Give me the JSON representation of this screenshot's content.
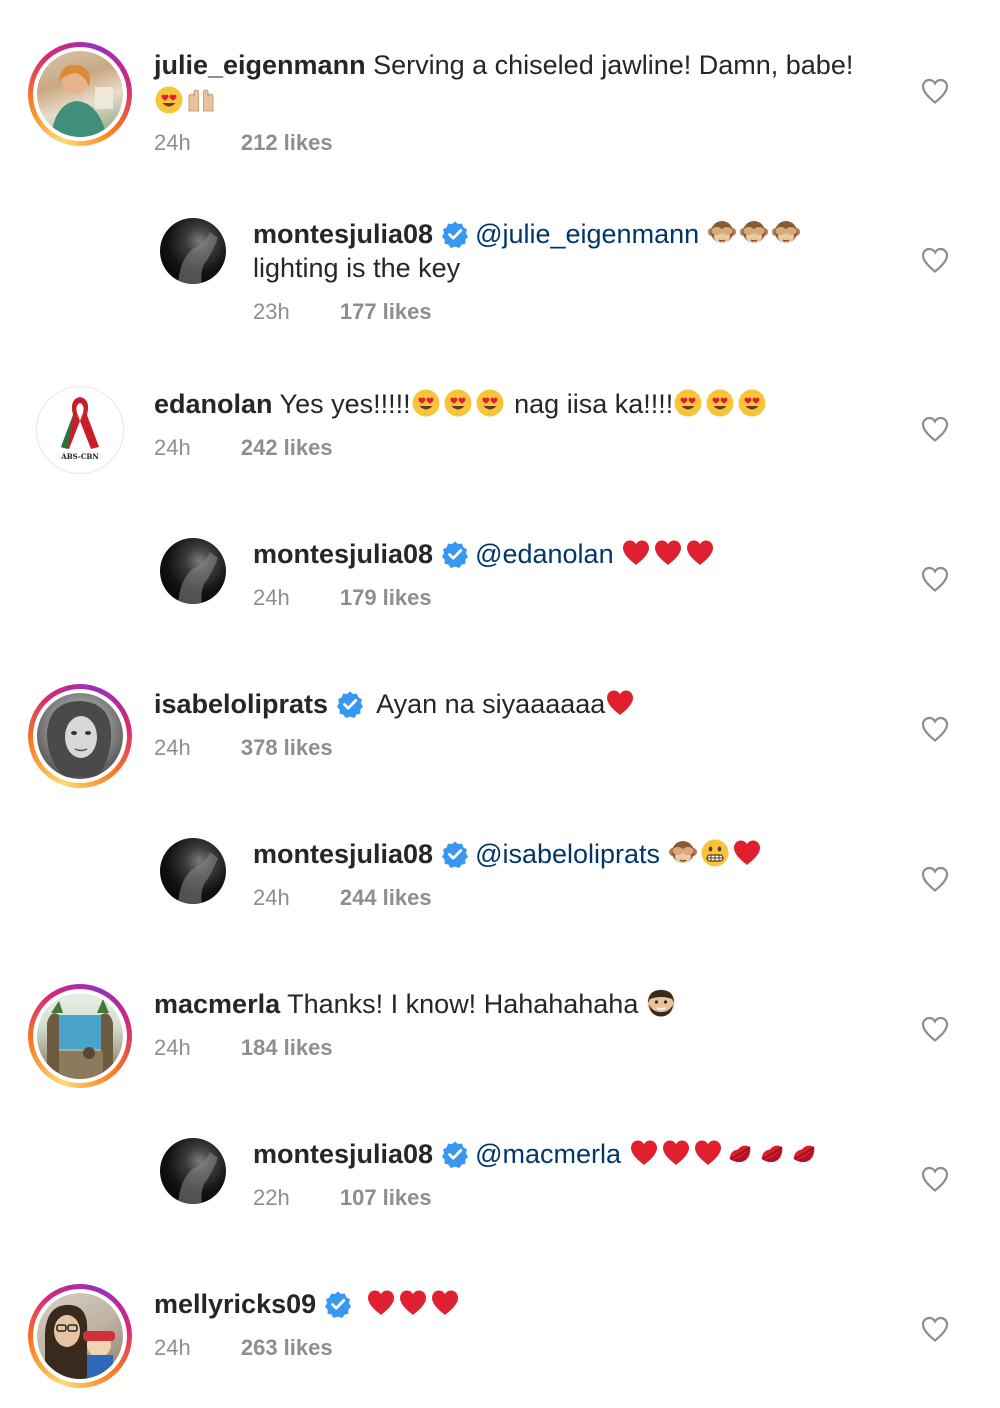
{
  "comments": [
    {
      "username": "julie_eigenmann",
      "text": "Serving a chiseled jawline! Damn, babe!",
      "time": "24h",
      "likes": "212 likes",
      "emojis": [
        "heart-eyes-emoji",
        "raised-hands-emoji"
      ]
    },
    {
      "username": "montesjulia08",
      "mention": "@julie_eigenmann",
      "text": "lighting is the key",
      "time": "23h",
      "likes": "177 likes",
      "emojis": [
        "see-no-evil-monkey-emoji",
        "see-no-evil-monkey-emoji",
        "see-no-evil-monkey-emoji"
      ]
    },
    {
      "username": "edanolan",
      "text": "Yes yes!!!!!",
      "text2": "nag iisa ka!!!!",
      "time": "24h",
      "likes": "242 likes",
      "logo_text": "ABS-CBN",
      "emojis": [
        "heart-eyes-emoji",
        "heart-eyes-emoji",
        "heart-eyes-emoji"
      ]
    },
    {
      "username": "montesjulia08",
      "mention": "@edanolan",
      "time": "24h",
      "likes": "179 likes",
      "emojis": [
        "red-heart-emoji",
        "red-heart-emoji",
        "red-heart-emoji"
      ]
    },
    {
      "username": "isabeloliprats",
      "text": "Ayan na siyaaaaaa",
      "time": "24h",
      "likes": "378 likes",
      "emojis": [
        "red-heart-emoji"
      ]
    },
    {
      "username": "montesjulia08",
      "mention": "@isabeloliprats",
      "time": "24h",
      "likes": "244 likes",
      "emojis": [
        "see-no-evil-monkey-emoji",
        "grimacing-face-emoji",
        "red-heart-emoji"
      ]
    },
    {
      "username": "macmerla",
      "text": "Thanks! I know! Hahahahaha",
      "time": "24h",
      "likes": "184 likes",
      "emojis": [
        "bearded-man-emoji"
      ]
    },
    {
      "username": "montesjulia08",
      "mention": "@macmerla",
      "time": "22h",
      "likes": "107 likes",
      "emojis": [
        "red-heart-emoji",
        "red-heart-emoji",
        "red-heart-emoji",
        "kiss-mark-emoji",
        "kiss-mark-emoji",
        "kiss-mark-emoji"
      ]
    },
    {
      "username": "mellyricks09",
      "time": "24h",
      "likes": "263 likes",
      "emojis": [
        "red-heart-emoji",
        "red-heart-emoji",
        "red-heart-emoji"
      ]
    }
  ],
  "icons": {
    "like": "heart-outline-icon",
    "verified": "verified-badge-icon"
  },
  "colors": {
    "verified": "#3897f0",
    "mention": "#00376b",
    "meta": "#8e8e8e",
    "heart": "#e0202e"
  }
}
